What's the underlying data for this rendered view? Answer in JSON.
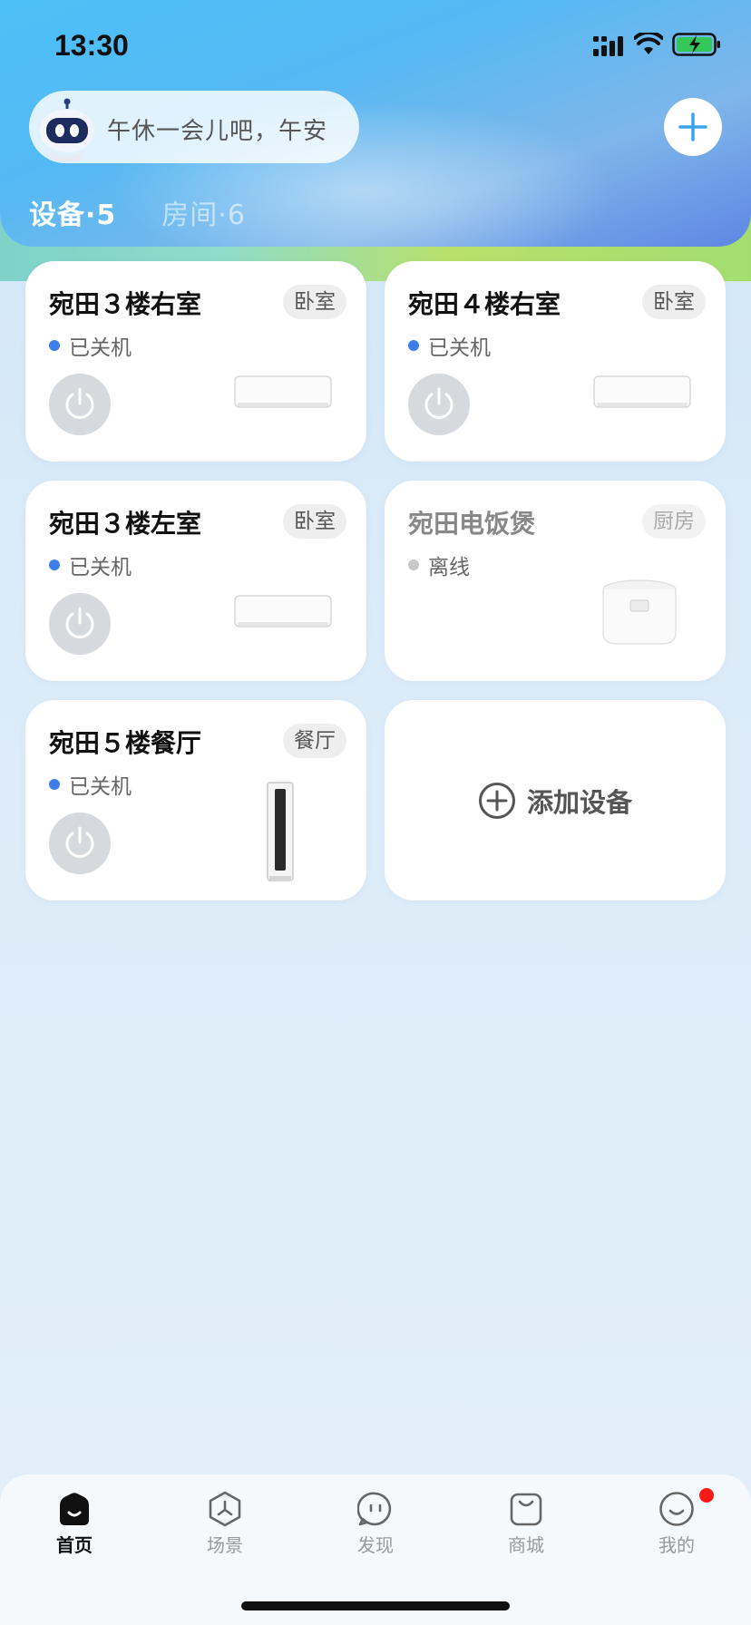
{
  "status_bar": {
    "time": "13:30"
  },
  "header": {
    "greeting": "午休一会儿吧，午安",
    "tabs": [
      {
        "label": "设备·5",
        "active": true
      },
      {
        "label": "房间·6",
        "active": false
      }
    ]
  },
  "devices": [
    {
      "name": "宛田３楼右室",
      "room": "卧室",
      "status": "已关机",
      "online": true,
      "type": "wall-ac"
    },
    {
      "name": "宛田４楼右室",
      "room": "卧室",
      "status": "已关机",
      "online": true,
      "type": "wall-ac"
    },
    {
      "name": "宛田３楼左室",
      "room": "卧室",
      "status": "已关机",
      "online": true,
      "type": "wall-ac"
    },
    {
      "name": "宛田电饭煲",
      "room": "厨房",
      "status": "离线",
      "online": false,
      "type": "rice-cooker"
    },
    {
      "name": "宛田５楼餐厅",
      "room": "餐厅",
      "status": "已关机",
      "online": true,
      "type": "tower-ac"
    }
  ],
  "add_device": {
    "label": "添加设备"
  },
  "bottom_nav": [
    {
      "label": "首页",
      "icon": "home-icon",
      "active": true
    },
    {
      "label": "场景",
      "icon": "scene-icon",
      "active": false
    },
    {
      "label": "发现",
      "icon": "discover-icon",
      "active": false
    },
    {
      "label": "商城",
      "icon": "mall-icon",
      "active": false
    },
    {
      "label": "我的",
      "icon": "profile-icon",
      "active": false
    }
  ],
  "colors": {
    "accent_blue": "#3d7fe6",
    "header_blue": "#4fc0f7",
    "notification_red": "#ff1a1a"
  }
}
